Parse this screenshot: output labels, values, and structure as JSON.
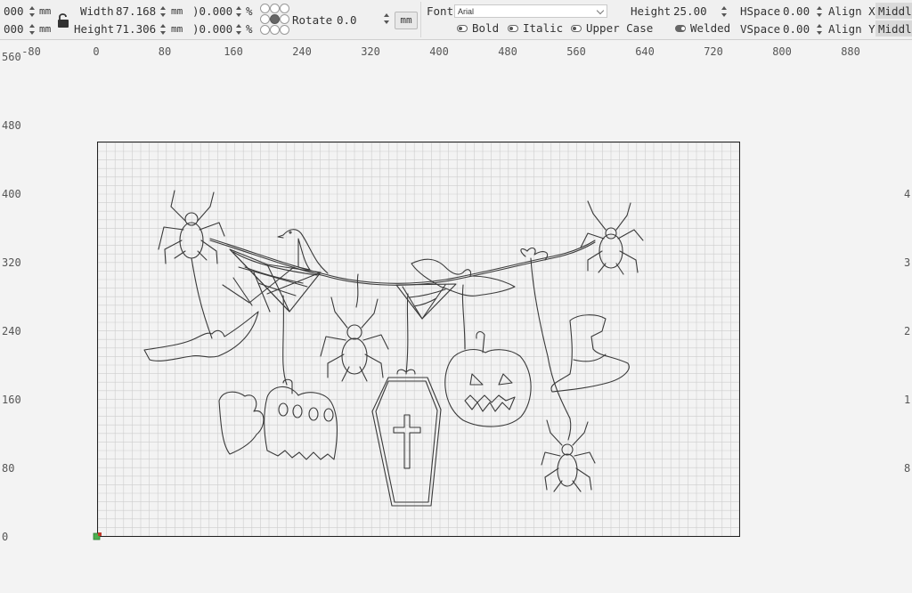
{
  "toolbar": {
    "pos_x": "000",
    "pos_y": "000",
    "pos_unit_x": "mm",
    "pos_unit_y": "mm",
    "width_label": "Width",
    "width_value": "87.168",
    "width_unit": "mm",
    "height_label": "Height",
    "height_value": "71.306",
    "height_unit": "mm",
    "scale_x": ")0.000",
    "scale_y": ")0.000",
    "scale_unit_x": "%",
    "scale_unit_y": "%",
    "rotate_label": "Rotate",
    "rotate_value": "0.0",
    "unit_button": "mm",
    "font_label": "Font",
    "font_value": "Arial",
    "bold_label": "Bold",
    "italic_label": "Italic",
    "upper_case_label": "Upper Case",
    "text_height_label": "Height",
    "text_height_value": "25.00",
    "welded_label": "Welded",
    "hspace_label": "HSpace",
    "hspace_value": "0.00",
    "vspace_label": "VSpace",
    "vspace_value": "0.00",
    "align_x_label": "Align X",
    "align_x_value": "Middl",
    "align_y_label": "Align Y",
    "align_y_value": "Middl"
  },
  "ruler": {
    "x_ticks": [
      "-80",
      "0",
      "80",
      "160",
      "240",
      "320",
      "400",
      "480",
      "560",
      "640",
      "720",
      "800",
      "880"
    ],
    "y_ticks": [
      "560",
      "480",
      "400",
      "320",
      "240",
      "160",
      "80",
      "0"
    ],
    "y_ticks_right": [
      "4",
      "3",
      "2",
      "1",
      "8"
    ]
  },
  "canvas": {
    "colors": {
      "bed_border": "#222222",
      "grid_minor": "#c8c8c8",
      "grid_major": "#b5b5b5",
      "art_stroke": "#3a3a3a",
      "origin_green": "#4caf50",
      "origin_red": "#c0392b"
    }
  }
}
